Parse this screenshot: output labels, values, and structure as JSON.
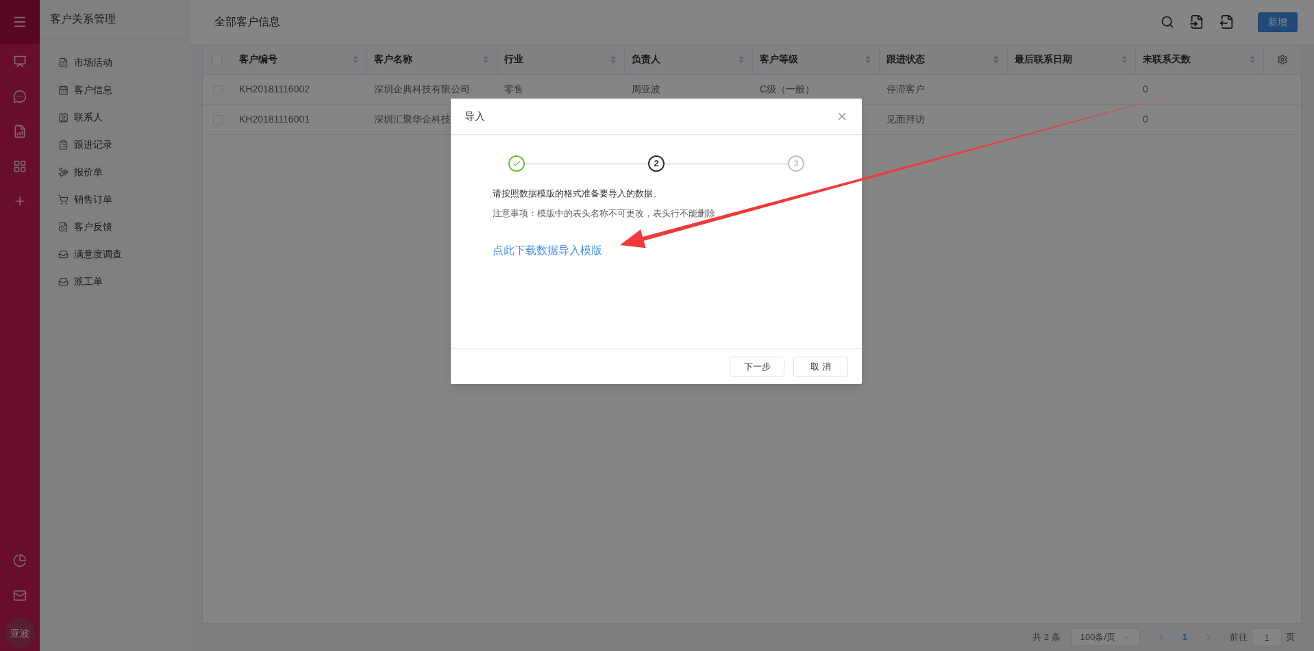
{
  "rail": {
    "avatar": "亚波"
  },
  "sidebar": {
    "title": "客户关系管理",
    "items": [
      {
        "label": "市场活动"
      },
      {
        "label": "客户信息"
      },
      {
        "label": "联系人"
      },
      {
        "label": "跟进记录"
      },
      {
        "label": "报价单"
      },
      {
        "label": "销售订单"
      },
      {
        "label": "客户反馈"
      },
      {
        "label": "满意度调查"
      },
      {
        "label": "派工单"
      }
    ]
  },
  "main": {
    "title": "全部客户信息",
    "new_button": "新增"
  },
  "table": {
    "all_checked": false,
    "columns": [
      "客户编号",
      "客户名称",
      "行业",
      "负责人",
      "客户等级",
      "跟进状态",
      "最后联系日期",
      "未联系天数"
    ],
    "rows": [
      {
        "checked": false,
        "cells": [
          "KH20181116002",
          "深圳企典科技有限公司",
          "零售",
          "周亚波",
          "C级（一般）",
          "停滞客户",
          "",
          "0"
        ]
      },
      {
        "checked": false,
        "cells": [
          "KH20181116001",
          "深圳汇聚华企科技",
          "",
          "",
          "",
          "见面拜访",
          "",
          "0"
        ]
      }
    ]
  },
  "pagination": {
    "total": "共 2 条",
    "page_size": "100条/页",
    "pages": [
      {
        "label": "1",
        "selected": true
      }
    ],
    "goto_label": "前往",
    "goto_value": "1",
    "goto_suffix": "页"
  },
  "dialog": {
    "title": "导入",
    "steps": [
      {
        "kind": "done"
      },
      {
        "kind": "current",
        "number": "2"
      },
      {
        "kind": "pending",
        "number": "3"
      }
    ],
    "instruction": "请按照数据模版的格式准备要导入的数据。",
    "note": "注意事项：模版中的表头名称不可更改，表头行不能删除",
    "link": "点此下载数据导入模版",
    "buttons": [
      "下一步",
      "取 消"
    ]
  }
}
